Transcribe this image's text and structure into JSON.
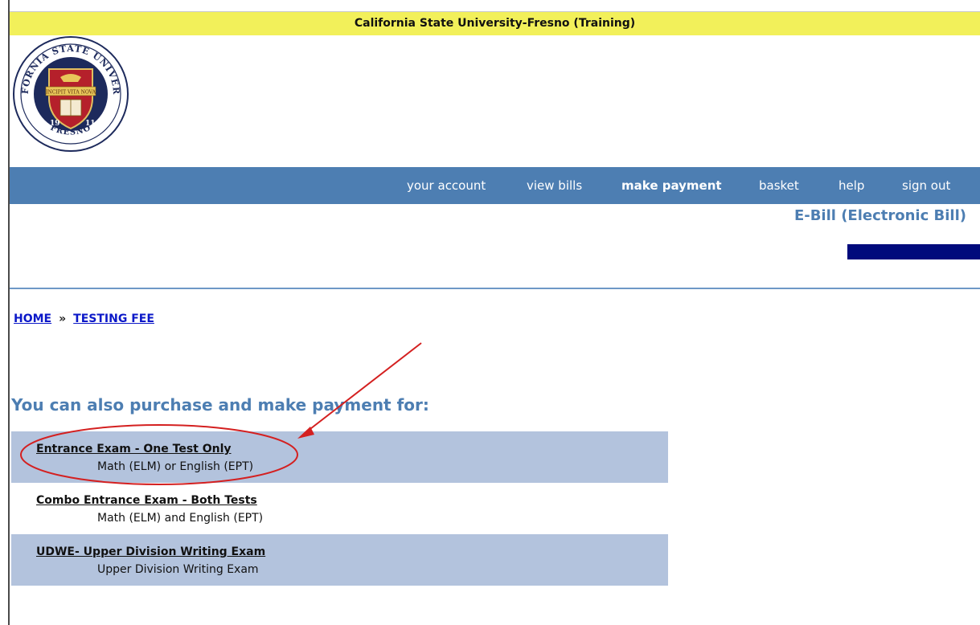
{
  "banner": {
    "title": "California State University-Fresno (Training)"
  },
  "logo": {
    "top_text": "CALIFORNIA STATE UNIVERSITY",
    "bottom_text": "FRESNO",
    "motto": "INCIPIT VITA NOVA",
    "year_left": "19",
    "year_right": "11"
  },
  "nav": {
    "items": [
      {
        "label": "your account",
        "active": false
      },
      {
        "label": "view bills",
        "active": false
      },
      {
        "label": "make payment",
        "active": true
      },
      {
        "label": "basket",
        "active": false
      },
      {
        "label": "help",
        "active": false
      },
      {
        "label": "sign out",
        "active": false
      }
    ]
  },
  "page": {
    "ebill_title": "E-Bill (Electronic Bill)"
  },
  "breadcrumb": {
    "home": "HOME",
    "separator": "»",
    "current": "TESTING FEE"
  },
  "main": {
    "heading": "You can also purchase and make payment for:",
    "options": [
      {
        "title": "Entrance Exam - One Test Only",
        "description": "Math (ELM) or English (EPT)",
        "shaded": true
      },
      {
        "title": "Combo Entrance Exam - Both Tests",
        "description": "Math (ELM) and English (EPT)",
        "shaded": false
      },
      {
        "title": "UDWE- Upper Division Writing Exam",
        "description": "Upper Division Writing Exam",
        "shaded": true
      }
    ]
  },
  "colors": {
    "banner": "#f2f05a",
    "nav": "#4d7eb2",
    "heading": "#4d7eb2",
    "row_shade": "#b3c3dd",
    "link": "#0b18c8",
    "navy_bar": "#000a7c",
    "annotation": "#d42020"
  }
}
